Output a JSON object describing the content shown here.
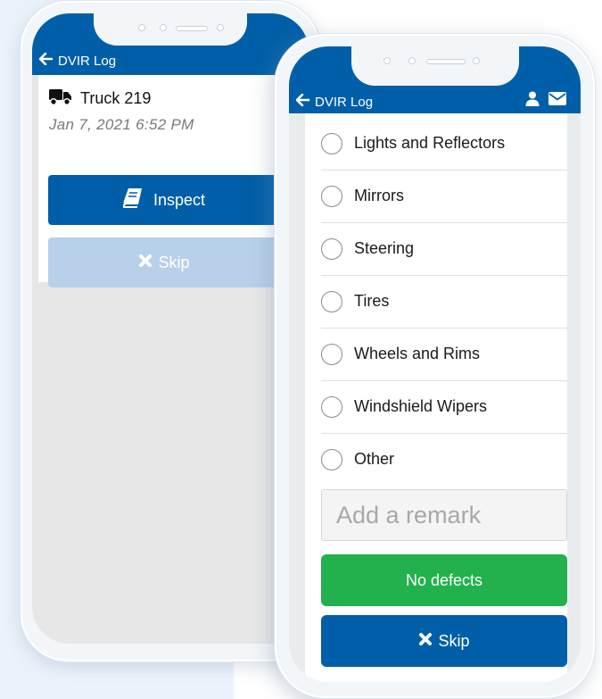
{
  "back_phone": {
    "header": {
      "title": "DVIR Log"
    },
    "vehicle": {
      "name": "Truck 219",
      "date": "Jan 7, 2021 6:52 PM"
    },
    "buttons": {
      "inspect_label": "Inspect",
      "skip_label": "Skip"
    }
  },
  "front_phone": {
    "header": {
      "title": "DVIR Log"
    },
    "checklist": [
      {
        "label": "Lights and Reflectors",
        "checked": false
      },
      {
        "label": "Mirrors",
        "checked": false
      },
      {
        "label": "Steering",
        "checked": false
      },
      {
        "label": "Tires",
        "checked": false
      },
      {
        "label": "Wheels and Rims",
        "checked": false
      },
      {
        "label": "Windshield Wipers",
        "checked": false
      },
      {
        "label": "Other",
        "checked": false
      }
    ],
    "remark": {
      "placeholder": "Add a remark"
    },
    "buttons": {
      "no_defects_label": "No defects",
      "skip_label": "Skip"
    }
  },
  "colors": {
    "primary": "#005fa8",
    "success": "#22b14c",
    "disabled": "#b8d0ea"
  },
  "icons": [
    "arrow-left-icon",
    "user-icon",
    "envelope-icon",
    "truck-icon",
    "book-icon",
    "times-icon",
    "radio-icon"
  ]
}
